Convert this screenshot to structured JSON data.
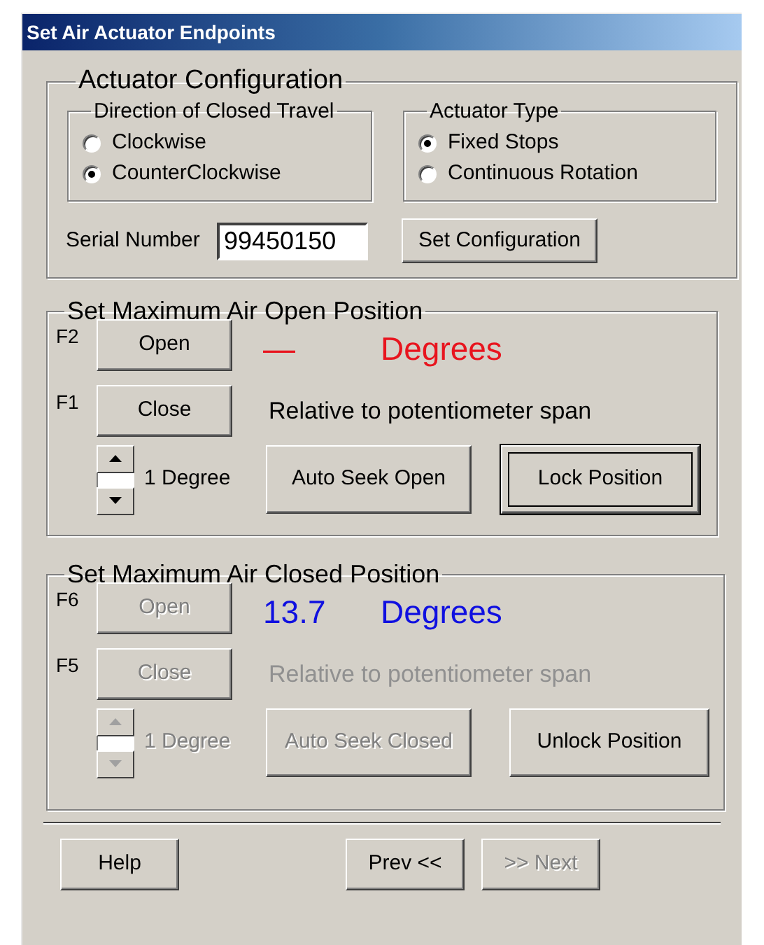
{
  "window": {
    "title": "Set Air Actuator Endpoints"
  },
  "configuration": {
    "title": "Actuator Configuration",
    "direction": {
      "title": "Direction of Closed Travel",
      "options": [
        {
          "label": "Clockwise",
          "selected": false
        },
        {
          "label": "CounterClockwise",
          "selected": true
        }
      ]
    },
    "actuator_type": {
      "title": "Actuator Type",
      "options": [
        {
          "label": "Fixed Stops",
          "selected": true
        },
        {
          "label": "Continuous Rotation",
          "selected": false
        }
      ]
    },
    "serial_number": {
      "label": "Serial Number",
      "value": "99450150"
    },
    "set_button": {
      "label": "Set Configuration"
    }
  },
  "positions": [
    {
      "title": "Set Maximum Air Open Position",
      "open": {
        "key": "F2",
        "label": "Open",
        "disabled": false
      },
      "close": {
        "key": "F1",
        "label": "Close",
        "disabled": false
      },
      "reading": {
        "value": "—",
        "unit": "Degrees",
        "color": "#e8141e"
      },
      "note": {
        "text": "Relative to potentiometer span",
        "disabled": false
      },
      "step": {
        "label": "1 Degree",
        "disabled": false
      },
      "seek_button": {
        "label": "Auto Seek Open",
        "disabled": false
      },
      "lock_button": {
        "label": "Lock Position",
        "focused": true
      }
    },
    {
      "title": "Set Maximum Air Closed Position",
      "open": {
        "key": "F6",
        "label": "Open",
        "disabled": true
      },
      "close": {
        "key": "F5",
        "label": "Close",
        "disabled": true
      },
      "reading": {
        "value": "13.7",
        "unit": "Degrees",
        "color": "#1010e0"
      },
      "note": {
        "text": "Relative to potentiometer span",
        "disabled": true
      },
      "step": {
        "label": "1 Degree",
        "disabled": true
      },
      "seek_button": {
        "label": "Auto Seek Closed",
        "disabled": true
      },
      "lock_button": {
        "label": "Unlock Position",
        "focused": false
      }
    }
  ],
  "footer": {
    "buttons": [
      {
        "label": "Help",
        "disabled": false
      },
      {
        "label": "Prev <<",
        "disabled": false
      },
      {
        "label": ">> Next",
        "disabled": true
      }
    ]
  }
}
